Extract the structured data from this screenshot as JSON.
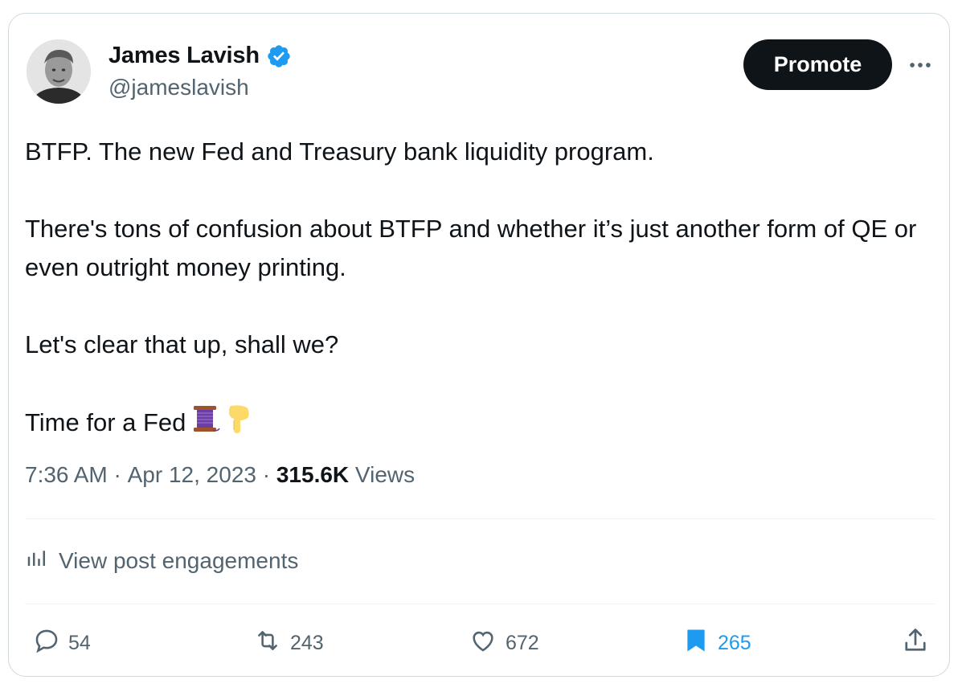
{
  "author": {
    "name": "James Lavish",
    "handle": "@jameslavish",
    "verified": true
  },
  "header": {
    "promote_label": "Promote",
    "more_icon": "more-horizontal-icon"
  },
  "tweet": {
    "paragraphs": [
      "BTFP. The new Fed and Treasury bank liquidity program.",
      "There's tons of confusion about BTFP and whether it’s just another form of QE or even outright money printing.",
      "Let's clear that up, shall we?",
      "Time for a Fed"
    ],
    "trailing_emoji": [
      "thread-spool-icon",
      "pointing-down-icon"
    ]
  },
  "meta": {
    "time": "7:36 AM",
    "separator": " · ",
    "date": "Apr 12, 2023",
    "views_count": "315.6K",
    "views_label": " Views"
  },
  "engagements": {
    "label": "View post engagements",
    "icon": "bar-chart-icon"
  },
  "actions": {
    "replies": "54",
    "reposts": "243",
    "likes": "672",
    "bookmarks": "265"
  },
  "colors": {
    "accent": "#1d9bf0",
    "text_primary": "#0f1419",
    "text_secondary": "#536471",
    "promote_bg": "#0f1419",
    "border": "#cfd9de"
  }
}
